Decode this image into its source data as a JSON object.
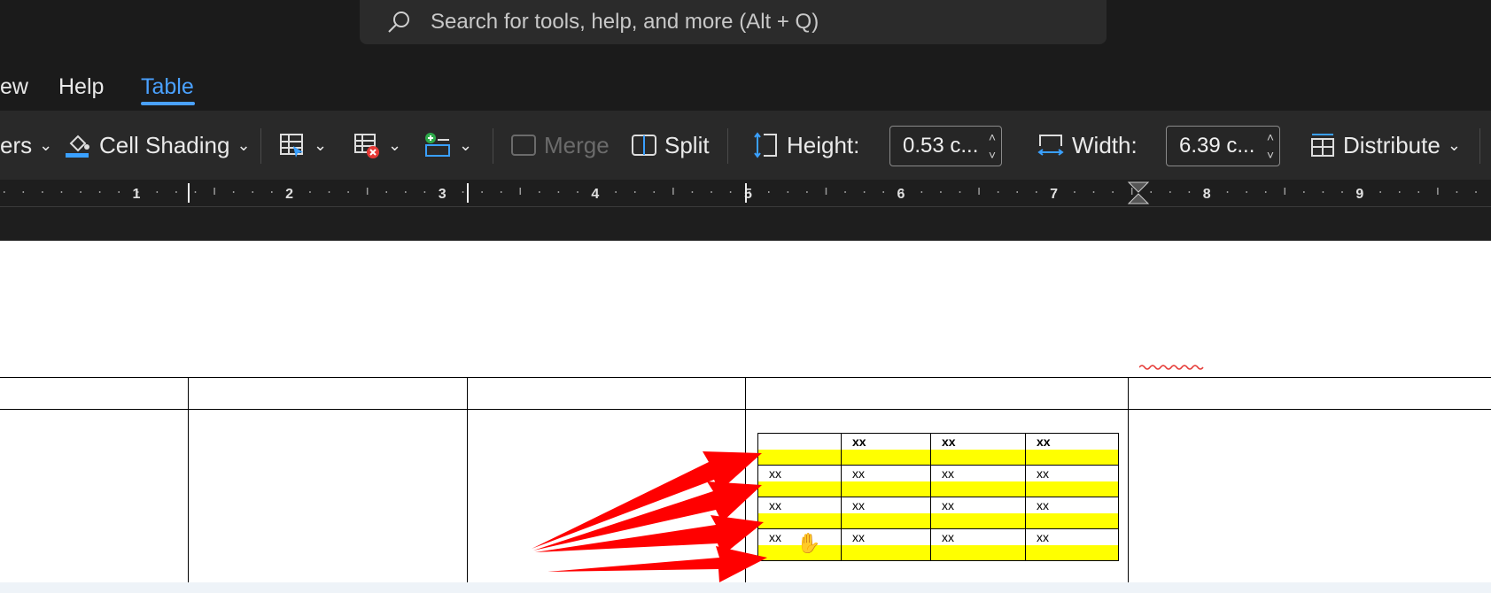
{
  "search": {
    "placeholder": "Search for tools, help, and more (Alt + Q)"
  },
  "menu": {
    "items": [
      {
        "label": "ew"
      },
      {
        "label": "Help"
      },
      {
        "label": "Table"
      }
    ],
    "active_tab": "Table"
  },
  "ribbon": {
    "borders_partial": "ers",
    "cell_shading": "Cell Shading",
    "merge": "Merge",
    "split": "Split",
    "height_label": "Height:",
    "height_value": "0.53 c...",
    "width_label": "Width:",
    "width_value": "6.39 c...",
    "distribute": "Distribute"
  },
  "ruler": {
    "numbers": [
      "1",
      "2",
      "3",
      "4",
      "5",
      "6",
      "7",
      "8",
      "9"
    ]
  },
  "nested_table": {
    "rows": [
      [
        "",
        "xx",
        "xx",
        "xx"
      ],
      [
        "xx",
        "xx",
        "xx",
        "xx"
      ],
      [
        "xx",
        "xx",
        "xx",
        "xx"
      ],
      [
        "xx",
        "xx",
        "xx",
        "xx"
      ]
    ],
    "highlight_color": "#ffff00"
  },
  "colors": {
    "accent": "#4aa1ff",
    "annotation_arrows": "#ff0000",
    "ribbon_bg": "#292929",
    "titlebar_bg": "#1b1b1b"
  }
}
